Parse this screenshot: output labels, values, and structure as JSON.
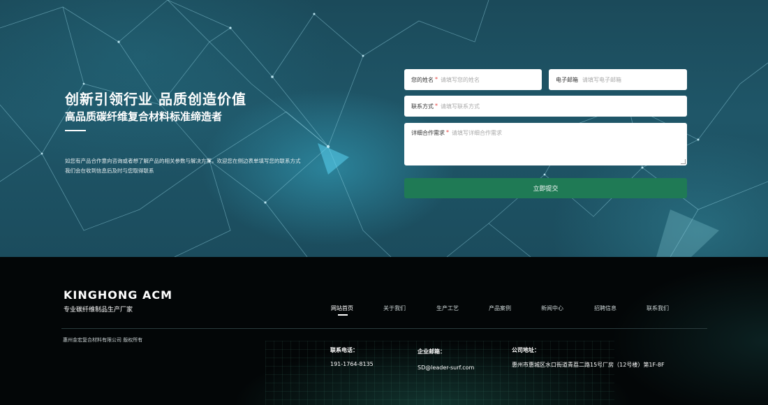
{
  "hero": {
    "title": "创新引领行业 品质创造价值",
    "subtitle": "高品质碳纤维复合材料标准缔造者",
    "desc_line1": "如您有产品合作意向咨询或者想了解产品的相关参数与解决方案，欢迎您在侧边表单填写您的联系方式",
    "desc_line2": "我们会在收到信息后及时与您取得联系"
  },
  "form": {
    "name": {
      "label": "您的姓名",
      "required": "*",
      "placeholder": "请填写您的姓名"
    },
    "email": {
      "label": "电子邮箱",
      "placeholder": "请填写电子邮箱"
    },
    "contact": {
      "label": "联系方式",
      "required": "*",
      "placeholder": "请填写联系方式"
    },
    "requirement": {
      "label": "详细合作需求",
      "required": "*",
      "placeholder": "请填写详细合作需求"
    },
    "submit_label": "立即提交",
    "submit_color": "#1f7a55"
  },
  "footer": {
    "brand": "KINGHONG ACM",
    "tagline": "专业碳纤维制品生产厂家",
    "nav": [
      {
        "label": "网站首页",
        "active": true
      },
      {
        "label": "关于我们"
      },
      {
        "label": "生产工艺"
      },
      {
        "label": "产品案例"
      },
      {
        "label": "新闻中心"
      },
      {
        "label": "招聘信息"
      },
      {
        "label": "联系我们"
      }
    ],
    "copyright": "惠州金宏复合材料有限公司 版权所有",
    "phone": {
      "label": "联系电话：",
      "value": "191-1764-8135"
    },
    "email": {
      "label": "企业邮箱：",
      "value": "SD@leader-surf.com"
    },
    "address": {
      "label": "公司地址：",
      "value": "惠州市惠城区水口街道青荔二路15号厂房（12号楼）第1F-8F"
    }
  }
}
